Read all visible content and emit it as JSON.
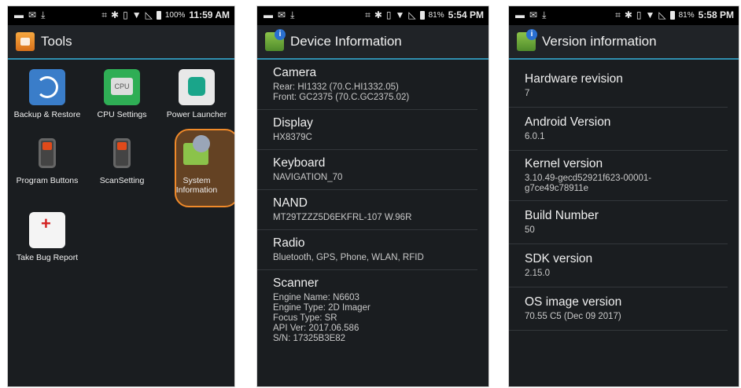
{
  "screen1": {
    "status": {
      "percent": "100%",
      "time": "11:59 AM"
    },
    "title": "Tools",
    "apps": [
      {
        "label": "Backup & Restore",
        "icon": "backup-restore-icon"
      },
      {
        "label": "CPU Settings",
        "icon": "cpu-settings-icon"
      },
      {
        "label": "Power Launcher",
        "icon": "power-launcher-icon"
      },
      {
        "label": "Program Buttons",
        "icon": "program-buttons-icon"
      },
      {
        "label": "ScanSetting",
        "icon": "scan-setting-icon"
      },
      {
        "label": "System Information",
        "icon": "system-information-icon"
      },
      {
        "label": "Take Bug Report",
        "icon": "take-bug-report-icon"
      }
    ]
  },
  "screen2": {
    "status": {
      "percent": "81%",
      "time": "5:54 PM"
    },
    "title": "Device Information",
    "items": [
      {
        "label": "Camera",
        "value": "Rear: HI1332 (70.C.HI1332.05)\nFront: GC2375 (70.C.GC2375.02)"
      },
      {
        "label": "Display",
        "value": "HX8379C"
      },
      {
        "label": "Keyboard",
        "value": "NAVIGATION_70"
      },
      {
        "label": "NAND",
        "value": "MT29TZZZ5D6EKFRL-107 W.96R"
      },
      {
        "label": "Radio",
        "value": "Bluetooth, GPS, Phone, WLAN, RFID"
      },
      {
        "label": "Scanner",
        "value": "Engine Name: N6603\nEngine Type: 2D Imager\nFocus Type: SR\nAPI Ver: 2017.06.586\nS/N: 17325B3E82"
      }
    ]
  },
  "screen3": {
    "status": {
      "percent": "81%",
      "time": "5:58 PM"
    },
    "title": "Version information",
    "items": [
      {
        "label": "Hardware revision",
        "value": "7"
      },
      {
        "label": "Android Version",
        "value": "6.0.1"
      },
      {
        "label": "Kernel version",
        "value": "3.10.49-gecd52921f623-00001-\ng7ce49c78911e"
      },
      {
        "label": "Build Number",
        "value": "50"
      },
      {
        "label": "SDK version",
        "value": "2.15.0"
      },
      {
        "label": "OS image version",
        "value": "70.55 C5 (Dec 09 2017)"
      }
    ]
  }
}
